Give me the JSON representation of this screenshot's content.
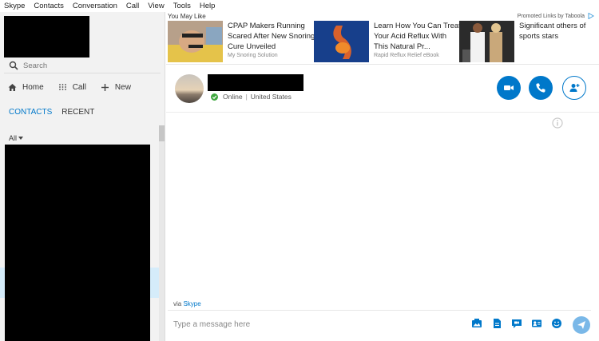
{
  "menu": {
    "items": [
      "Skype",
      "Contacts",
      "Conversation",
      "Call",
      "View",
      "Tools",
      "Help"
    ]
  },
  "sidebar": {
    "search_placeholder": "Search",
    "nav": [
      {
        "label": "Home",
        "icon": "home-icon"
      },
      {
        "label": "Call",
        "icon": "dialpad-icon"
      },
      {
        "label": "New",
        "icon": "plus-icon"
      }
    ],
    "tabs": [
      {
        "label": "CONTACTS",
        "active": true
      },
      {
        "label": "RECENT",
        "active": false
      }
    ],
    "filter_label": "All"
  },
  "ads": {
    "heading": "You May Like",
    "promoted": "Promoted Links by Taboola",
    "items": [
      {
        "title": "CPAP Makers Running Scared After New Snoring Cure Unveiled",
        "source": "My Snoring Solution"
      },
      {
        "title": "Learn How You Can Treat Your Acid Reflux With This Natural Pr...",
        "source": "Rapid Reflux Relief eBook"
      },
      {
        "title": "Significant others of sports stars",
        "source": ""
      }
    ]
  },
  "conversation": {
    "status": "Online",
    "location": "United States",
    "via_prefix": "via",
    "via_link": "Skype",
    "composer_placeholder": "Type a message here"
  },
  "colors": {
    "accent": "#0078ca",
    "online": "#3fa73f",
    "selection": "#d5ecfa"
  }
}
